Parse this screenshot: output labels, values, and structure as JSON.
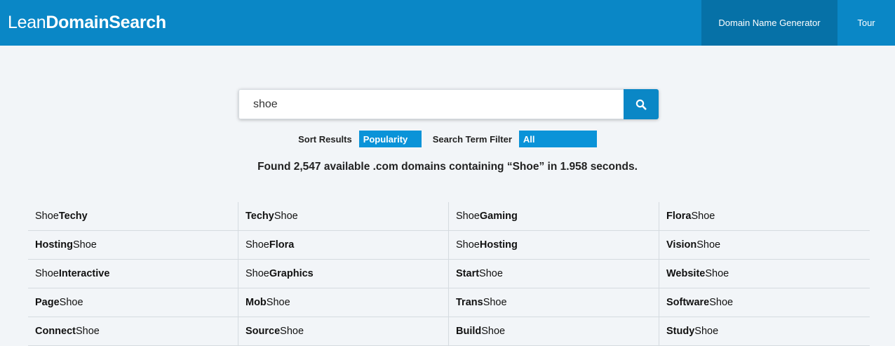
{
  "header": {
    "logo_light": "Lean",
    "logo_bold": "DomainSearch",
    "nav": [
      {
        "label": "Domain Name Generator"
      },
      {
        "label": "Tour"
      }
    ]
  },
  "search": {
    "value": "shoe",
    "icon": "search-icon"
  },
  "filters": {
    "sort_label": "Sort Results",
    "sort_value": "Popularity",
    "term_label": "Search Term Filter",
    "term_value": "All"
  },
  "results": {
    "summary": "Found 2,547 available .com domains containing “Shoe” in 1.958 seconds.",
    "rows": [
      [
        {
          "plain": "Shoe",
          "bold": "Techy",
          "bold_first": false
        },
        {
          "plain": "Shoe",
          "bold": "Techy",
          "bold_first": true
        },
        {
          "plain": "Shoe",
          "bold": "Gaming",
          "bold_first": false
        },
        {
          "plain": "Shoe",
          "bold": "Flora",
          "bold_first": true
        }
      ],
      [
        {
          "plain": "Shoe",
          "bold": "Hosting",
          "bold_first": true
        },
        {
          "plain": "Shoe",
          "bold": "Flora",
          "bold_first": false
        },
        {
          "plain": "Shoe",
          "bold": "Hosting",
          "bold_first": false
        },
        {
          "plain": "Shoe",
          "bold": "Vision",
          "bold_first": true
        }
      ],
      [
        {
          "plain": "Shoe",
          "bold": "Interactive",
          "bold_first": false
        },
        {
          "plain": "Shoe",
          "bold": "Graphics",
          "bold_first": false
        },
        {
          "plain": "Shoe",
          "bold": "Start",
          "bold_first": true
        },
        {
          "plain": "Shoe",
          "bold": "Website",
          "bold_first": true
        }
      ],
      [
        {
          "plain": "Shoe",
          "bold": "Page",
          "bold_first": true
        },
        {
          "plain": "Shoe",
          "bold": "Mob",
          "bold_first": true
        },
        {
          "plain": "Shoe",
          "bold": "Trans",
          "bold_first": true
        },
        {
          "plain": "Shoe",
          "bold": "Software",
          "bold_first": true
        }
      ],
      [
        {
          "plain": "Shoe",
          "bold": "Connect",
          "bold_first": true
        },
        {
          "plain": "Shoe",
          "bold": "Source",
          "bold_first": true
        },
        {
          "plain": "Shoe",
          "bold": "Build",
          "bold_first": true
        },
        {
          "plain": "Shoe",
          "bold": "Study",
          "bold_first": true
        }
      ]
    ]
  },
  "colors": {
    "brand": "#0a87c6",
    "nav_active": "#0671a7",
    "select_bg": "#0a93d8",
    "page_bg": "#f2f5f8"
  }
}
